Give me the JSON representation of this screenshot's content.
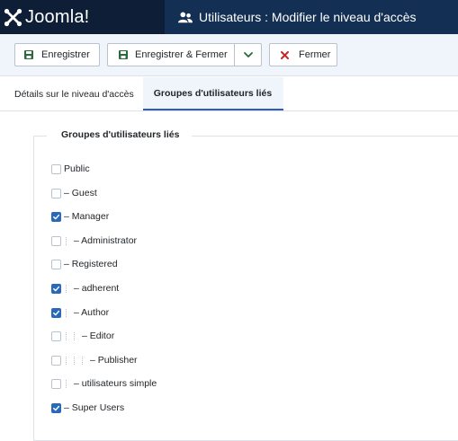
{
  "header": {
    "brand_text": "Joomla!",
    "title": "Utilisateurs : Modifier le niveau d'accès"
  },
  "toolbar": {
    "save_label": "Enregistrer",
    "save_close_label": "Enregistrer & Fermer",
    "close_label": "Fermer"
  },
  "tabs": [
    {
      "label": "Détails sur le niveau d'accès",
      "active": false
    },
    {
      "label": "Groupes d'utilisateurs liés",
      "active": true
    }
  ],
  "fieldset": {
    "legend": "Groupes d'utilisateurs liés"
  },
  "groups": [
    {
      "label": "Public",
      "checked": false,
      "level": 0
    },
    {
      "label": "– Guest",
      "checked": false,
      "level": 0
    },
    {
      "label": "– Manager",
      "checked": true,
      "level": 0
    },
    {
      "label": "– Administrator",
      "checked": false,
      "level": 1
    },
    {
      "label": "– Registered",
      "checked": false,
      "level": 0
    },
    {
      "label": "– adherent",
      "checked": true,
      "level": 1
    },
    {
      "label": "– Author",
      "checked": true,
      "level": 1
    },
    {
      "label": "– Editor",
      "checked": false,
      "level": 2
    },
    {
      "label": "– Publisher",
      "checked": false,
      "level": 3
    },
    {
      "label": "– utilisateurs simple",
      "checked": false,
      "level": 1
    },
    {
      "label": "– Super Users",
      "checked": true,
      "level": 0
    }
  ],
  "colors": {
    "brand_bg": "#0e1e36",
    "titlebar_bg": "#132f53",
    "toolbar_bg": "#f0f4fb",
    "save_icon": "#2a6a3a",
    "close_icon": "#c52827",
    "checkbox_checked": "#2a69b8",
    "tab_active_border": "#2f5abf"
  },
  "icons": {
    "brand": "joomla-logo-icon",
    "title": "users-icon",
    "save": "floppy-disk-icon",
    "save_close": "floppy-disk-icon",
    "dropdown": "chevron-down-icon",
    "close": "close-x-icon"
  }
}
